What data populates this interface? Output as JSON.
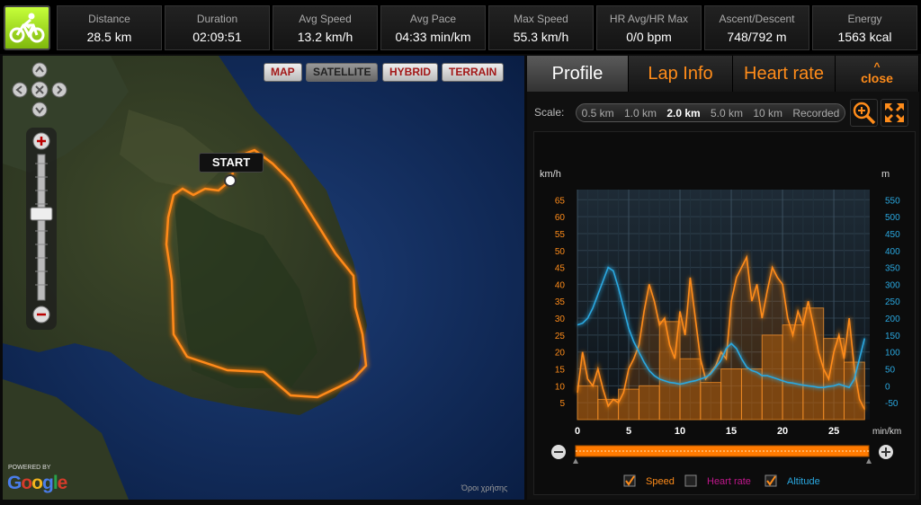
{
  "stats": [
    {
      "label": "Distance",
      "value": "28.5 km"
    },
    {
      "label": "Duration",
      "value": "02:09:51"
    },
    {
      "label": "Avg Speed",
      "value": "13.2 km/h"
    },
    {
      "label": "Avg Pace",
      "value": "04:33 min/km"
    },
    {
      "label": "Max Speed",
      "value": "55.3 km/h"
    },
    {
      "label": "HR Avg/HR Max",
      "value": "0/0 bpm"
    },
    {
      "label": "Ascent/Descent",
      "value": "748/792 m"
    },
    {
      "label": "Energy",
      "value": "1563 kcal"
    }
  ],
  "sport_icon": "bicycle-icon",
  "map": {
    "types": [
      "MAP",
      "SATELLITE",
      "HYBRID",
      "TERRAIN"
    ],
    "active_type": "SATELLITE",
    "start_label": "START",
    "powered_by": "POWERED BY",
    "logo": "Google",
    "copyright": "Όροι χρήσης",
    "route_color": "#ff7a00"
  },
  "tabs": {
    "profile": "Profile",
    "lap_info": "Lap Info",
    "heart_rate": "Heart rate",
    "close": "close"
  },
  "scale": {
    "label": "Scale:",
    "options": [
      "0.5 km",
      "1.0 km",
      "2.0 km",
      "5.0 km",
      "10 km",
      "Recorded"
    ],
    "selected": "2.0 km"
  },
  "chart_data": {
    "type": "line",
    "x_unit": "min/km",
    "left_unit": "km/h",
    "right_unit": "m",
    "x_ticks": [
      0,
      5,
      10,
      15,
      20,
      25
    ],
    "left_ticks": [
      5,
      10,
      15,
      20,
      25,
      30,
      35,
      40,
      45,
      50,
      55,
      60,
      65
    ],
    "right_ticks": [
      -50,
      0,
      50,
      100,
      150,
      200,
      250,
      300,
      350,
      400,
      450,
      500,
      550
    ],
    "xlim": [
      0,
      28.5
    ],
    "ylim_left": [
      0,
      68
    ],
    "ylim_right": [
      -100,
      580
    ],
    "grid": true,
    "speed_bars": {
      "bin_km": 2.0,
      "values": [
        10,
        6,
        9,
        10,
        29,
        18,
        11,
        15,
        15,
        25,
        28,
        33,
        24,
        17
      ]
    },
    "series": [
      {
        "name": "Speed",
        "color": "#ff8c1a",
        "x": [
          0,
          0.5,
          1,
          1.5,
          2,
          2.5,
          3,
          3.5,
          4,
          4.5,
          5,
          5.5,
          6,
          6.5,
          7,
          7.5,
          8,
          8.5,
          9,
          9.5,
          10,
          10.5,
          11,
          11.5,
          12,
          12.5,
          13,
          13.5,
          14,
          14.5,
          15,
          15.5,
          16,
          16.5,
          17,
          17.5,
          18,
          18.5,
          19,
          19.5,
          20,
          20.5,
          21,
          21.5,
          22,
          22.5,
          23,
          23.5,
          24,
          24.5,
          25,
          25.5,
          26,
          26.5,
          27,
          27.5,
          28
        ],
        "values": [
          8,
          20,
          12,
          10,
          15,
          9,
          4,
          6,
          5,
          8,
          15,
          18,
          22,
          32,
          40,
          35,
          28,
          30,
          22,
          18,
          32,
          25,
          42,
          30,
          18,
          12,
          14,
          16,
          20,
          18,
          35,
          42,
          45,
          48,
          35,
          40,
          30,
          38,
          45,
          42,
          40,
          30,
          25,
          32,
          28,
          35,
          28,
          20,
          15,
          12,
          20,
          25,
          18,
          30,
          15,
          6,
          3
        ]
      },
      {
        "name": "Altitude",
        "color": "#2aa8e0",
        "x": [
          0,
          0.5,
          1,
          1.5,
          2,
          2.5,
          3,
          3.5,
          4,
          4.5,
          5,
          5.5,
          6,
          6.5,
          7,
          7.5,
          8,
          8.5,
          9,
          9.5,
          10,
          10.5,
          11,
          11.5,
          12,
          12.5,
          13,
          13.5,
          14,
          14.5,
          15,
          15.5,
          16,
          16.5,
          17,
          17.5,
          18,
          18.5,
          19,
          19.5,
          20,
          20.5,
          21,
          21.5,
          22,
          22.5,
          23,
          23.5,
          24,
          24.5,
          25,
          25.5,
          26,
          26.5,
          27,
          27.5,
          28
        ],
        "values": [
          180,
          185,
          200,
          230,
          270,
          310,
          350,
          340,
          290,
          230,
          170,
          130,
          100,
          70,
          45,
          30,
          20,
          15,
          10,
          8,
          5,
          8,
          12,
          15,
          20,
          25,
          35,
          55,
          75,
          110,
          125,
          110,
          80,
          55,
          45,
          40,
          30,
          30,
          25,
          20,
          15,
          10,
          8,
          5,
          2,
          0,
          -2,
          -5,
          -5,
          -2,
          0,
          5,
          0,
          -5,
          20,
          80,
          140
        ]
      },
      {
        "name": "Heart rate",
        "color": "#c0188c",
        "x": [],
        "values": []
      }
    ],
    "legend": [
      {
        "name": "Speed",
        "checked": true
      },
      {
        "name": "Heart rate",
        "checked": false
      },
      {
        "name": "Altitude",
        "checked": true
      }
    ],
    "legend_position": "bottom"
  }
}
